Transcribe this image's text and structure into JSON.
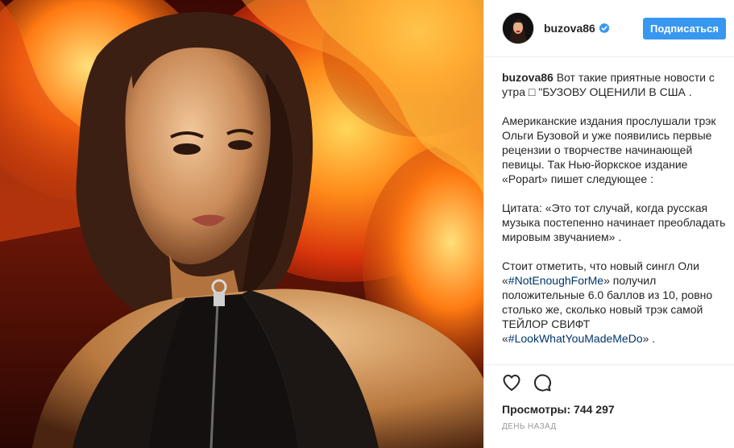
{
  "header": {
    "username": "buzova86",
    "follow_label": "Подписаться",
    "verified": true
  },
  "caption": {
    "username": "buzova86",
    "intro": " Вот такие приятные новости с утра □ \"БУЗОВУ ОЦЕНИЛИ В США .",
    "para2": "Американские издания прослушали трэк Ольги Бузовой и уже появились первые рецензии о творчестве начинающей певицы. Так Нью-йоркское издание «Popart» пишет следующее :",
    "para3": "Цитата: «Это тот случай, когда русская музыка постепенно начинает преобладать мировым звучанием» .",
    "para4_a": "Стоит отметить, что новый сингл Оли «",
    "hashtag1": "#NotEnoughForMe",
    "para4_b": "» получил положительные 6.0 баллов из 10, ровно столько же, сколько новый трэк самой ТЕЙЛОР СВИФТ «",
    "hashtag2": "#LookWhatYouMadeMeDo",
    "para4_c": "» ."
  },
  "stats": {
    "views": "Просмотры: 744 297",
    "time": "ДЕНЬ НАЗАД"
  },
  "colors": {
    "accent": "#3897f0",
    "hashtag": "#003569",
    "verified": "#3897f0"
  },
  "icons": {
    "like": "heart-icon",
    "comment": "comment-icon"
  }
}
